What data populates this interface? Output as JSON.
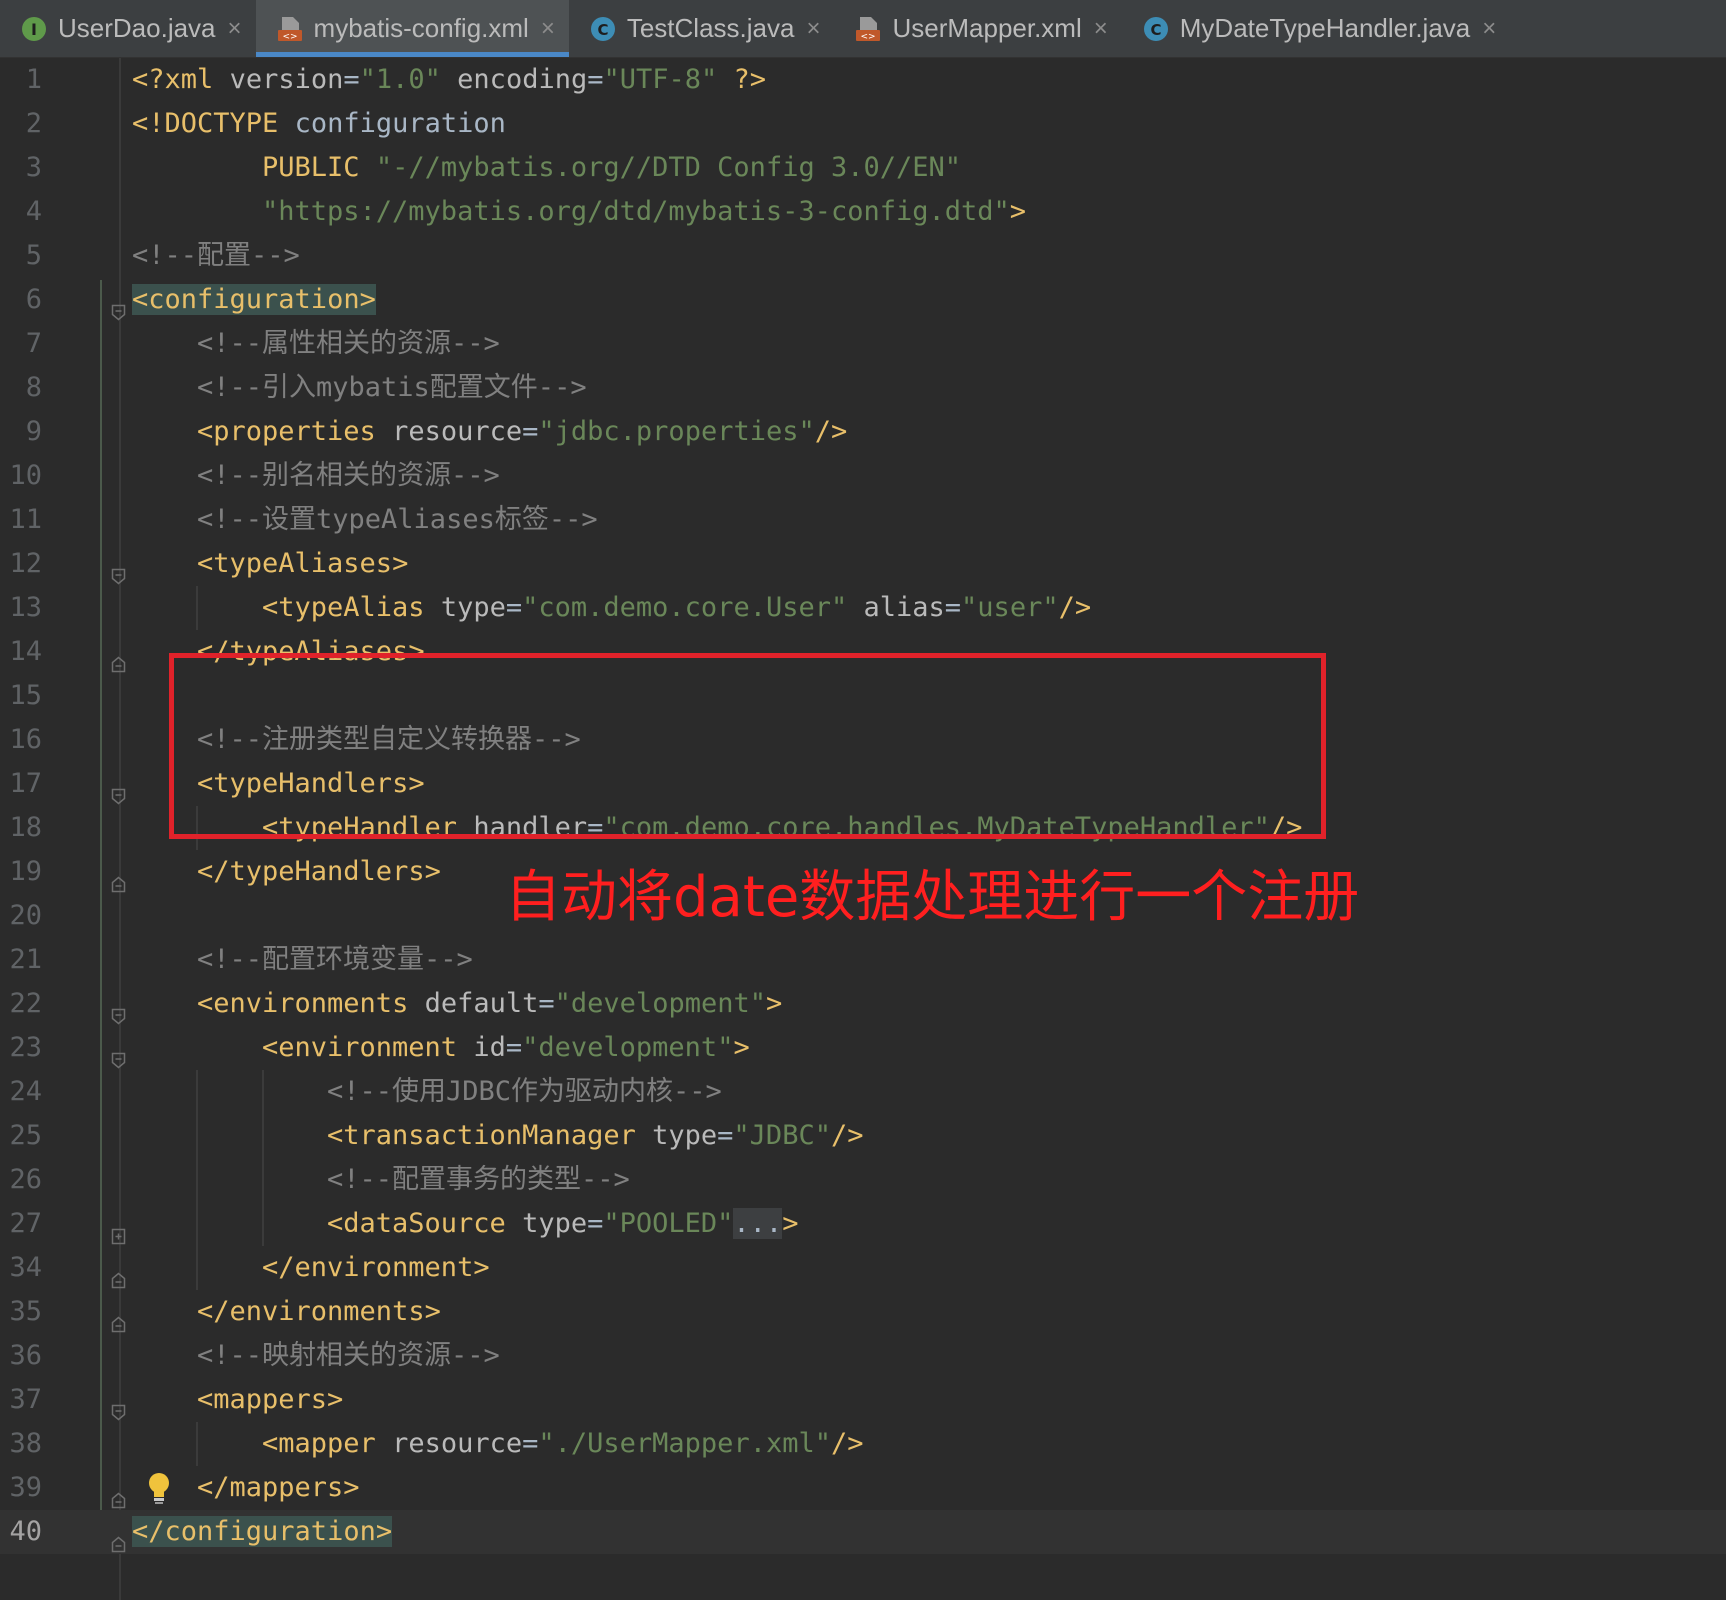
{
  "colors": {
    "background": "#2b2b2b",
    "tag": "#e8bf6a",
    "attribute": "#bababa",
    "value": "#6a8759",
    "comment": "#808080",
    "annotation": "#e0222a",
    "active_tab_underline": "#4a88c7"
  },
  "tabs": [
    {
      "label": "UserDao.java",
      "icon": "interface-icon",
      "active": false
    },
    {
      "label": "mybatis-config.xml",
      "icon": "xml-file-icon",
      "active": true
    },
    {
      "label": "TestClass.java",
      "icon": "class-icon",
      "active": false
    },
    {
      "label": "UserMapper.xml",
      "icon": "xml-file-icon",
      "active": false
    },
    {
      "label": "MyDateTypeHandler.java",
      "icon": "class-icon",
      "active": false
    }
  ],
  "tab_close_glyph": "×",
  "lines": [
    {
      "n": "1",
      "indent": 0,
      "tokens": [
        [
          "pi",
          "<?"
        ],
        [
          "tag",
          "xml"
        ],
        [
          "txt",
          " "
        ],
        [
          "attr",
          "version"
        ],
        [
          "txt",
          "="
        ],
        [
          "val",
          "\"1.0\""
        ],
        [
          "txt",
          " "
        ],
        [
          "attr",
          "encoding"
        ],
        [
          "txt",
          "="
        ],
        [
          "val",
          "\"UTF-8\""
        ],
        [
          "txt",
          " "
        ],
        [
          "pi",
          "?>"
        ]
      ]
    },
    {
      "n": "2",
      "indent": 0,
      "tokens": [
        [
          "tag",
          "<!DOCTYPE"
        ],
        [
          "txt",
          " configuration"
        ]
      ]
    },
    {
      "n": "3",
      "indent": 8,
      "tokens": [
        [
          "tag",
          "PUBLIC"
        ],
        [
          "txt",
          " "
        ],
        [
          "val",
          "\"-//mybatis.org//DTD Config 3.0//EN\""
        ]
      ]
    },
    {
      "n": "4",
      "indent": 8,
      "tokens": [
        [
          "val",
          "\"https://mybatis.org/dtd/mybatis-3-config.dtd\""
        ],
        [
          "tag",
          ">"
        ]
      ]
    },
    {
      "n": "5",
      "indent": 0,
      "tokens": [
        [
          "cmt",
          "<!--配置-->"
        ]
      ]
    },
    {
      "n": "6",
      "indent": 0,
      "fold": "open",
      "tokens": [
        [
          "matched",
          "<configuration>"
        ]
      ]
    },
    {
      "n": "7",
      "indent": 4,
      "tokens": [
        [
          "cmt",
          "<!--属性相关的资源-->"
        ]
      ]
    },
    {
      "n": "8",
      "indent": 4,
      "tokens": [
        [
          "cmt",
          "<!--引入mybatis配置文件-->"
        ]
      ]
    },
    {
      "n": "9",
      "indent": 4,
      "tokens": [
        [
          "tag",
          "<properties"
        ],
        [
          "txt",
          " "
        ],
        [
          "attr",
          "resource"
        ],
        [
          "txt",
          "="
        ],
        [
          "val",
          "\"jdbc.properties\""
        ],
        [
          "tag",
          "/>"
        ]
      ]
    },
    {
      "n": "10",
      "indent": 4,
      "tokens": [
        [
          "cmt",
          "<!--别名相关的资源-->"
        ]
      ]
    },
    {
      "n": "11",
      "indent": 4,
      "tokens": [
        [
          "cmt",
          "<!--设置typeAliases标签-->"
        ]
      ]
    },
    {
      "n": "12",
      "indent": 4,
      "fold": "open",
      "tokens": [
        [
          "tag",
          "<typeAliases>"
        ]
      ]
    },
    {
      "n": "13",
      "indent": 8,
      "tokens": [
        [
          "tag",
          "<typeAlias"
        ],
        [
          "txt",
          " "
        ],
        [
          "attr",
          "type"
        ],
        [
          "txt",
          "="
        ],
        [
          "val",
          "\"com.demo.core.User\""
        ],
        [
          "txt",
          " "
        ],
        [
          "attr",
          "alias"
        ],
        [
          "txt",
          "="
        ],
        [
          "val",
          "\"user\""
        ],
        [
          "tag",
          "/>"
        ]
      ]
    },
    {
      "n": "14",
      "indent": 4,
      "fold": "close",
      "tokens": [
        [
          "tag",
          "</typeAliases>"
        ]
      ]
    },
    {
      "n": "15",
      "indent": 0,
      "tokens": []
    },
    {
      "n": "16",
      "indent": 4,
      "tokens": [
        [
          "cmt",
          "<!--注册类型自定义转换器-->"
        ]
      ]
    },
    {
      "n": "17",
      "indent": 4,
      "fold": "open",
      "tokens": [
        [
          "tag",
          "<typeHandlers>"
        ]
      ]
    },
    {
      "n": "18",
      "indent": 8,
      "tokens": [
        [
          "tag",
          "<typeHandler"
        ],
        [
          "txt",
          " "
        ],
        [
          "attr",
          "handler"
        ],
        [
          "txt",
          "="
        ],
        [
          "val",
          "\"com.demo.core.handles.MyDateTypeHandler\""
        ],
        [
          "tag",
          "/>"
        ]
      ]
    },
    {
      "n": "19",
      "indent": 4,
      "fold": "close",
      "tokens": [
        [
          "tag",
          "</typeHandlers>"
        ]
      ]
    },
    {
      "n": "20",
      "indent": 0,
      "tokens": []
    },
    {
      "n": "21",
      "indent": 4,
      "tokens": [
        [
          "cmt",
          "<!--配置环境变量-->"
        ]
      ]
    },
    {
      "n": "22",
      "indent": 4,
      "fold": "open",
      "tokens": [
        [
          "tag",
          "<environments"
        ],
        [
          "txt",
          " "
        ],
        [
          "attr",
          "default"
        ],
        [
          "txt",
          "="
        ],
        [
          "val",
          "\"development\""
        ],
        [
          "tag",
          ">"
        ]
      ]
    },
    {
      "n": "23",
      "indent": 8,
      "fold": "open",
      "tokens": [
        [
          "tag",
          "<environment"
        ],
        [
          "txt",
          " "
        ],
        [
          "attr",
          "id"
        ],
        [
          "txt",
          "="
        ],
        [
          "val",
          "\"development\""
        ],
        [
          "tag",
          ">"
        ]
      ]
    },
    {
      "n": "24",
      "indent": 12,
      "tokens": [
        [
          "cmt",
          "<!--使用JDBC作为驱动内核-->"
        ]
      ]
    },
    {
      "n": "25",
      "indent": 12,
      "tokens": [
        [
          "tag",
          "<transactionManager"
        ],
        [
          "txt",
          " "
        ],
        [
          "attr",
          "type"
        ],
        [
          "txt",
          "="
        ],
        [
          "val",
          "\"JDBC\""
        ],
        [
          "tag",
          "/>"
        ]
      ]
    },
    {
      "n": "26",
      "indent": 12,
      "tokens": [
        [
          "cmt",
          "<!--配置事务的类型-->"
        ]
      ]
    },
    {
      "n": "27",
      "indent": 12,
      "fold": "plus",
      "tokens": [
        [
          "tag",
          "<dataSource"
        ],
        [
          "txt",
          " "
        ],
        [
          "attr",
          "type"
        ],
        [
          "txt",
          "="
        ],
        [
          "val",
          "\"POOLED\""
        ],
        [
          "collapsed",
          "..."
        ],
        [
          "tag",
          ">"
        ]
      ]
    },
    {
      "n": "34",
      "indent": 8,
      "fold": "close",
      "tokens": [
        [
          "tag",
          "</environment>"
        ]
      ]
    },
    {
      "n": "35",
      "indent": 4,
      "fold": "close",
      "tokens": [
        [
          "tag",
          "</environments>"
        ]
      ]
    },
    {
      "n": "36",
      "indent": 4,
      "tokens": [
        [
          "cmt",
          "<!--映射相关的资源-->"
        ]
      ]
    },
    {
      "n": "37",
      "indent": 4,
      "fold": "open",
      "tokens": [
        [
          "tag",
          "<mappers>"
        ]
      ]
    },
    {
      "n": "38",
      "indent": 8,
      "tokens": [
        [
          "tag",
          "<mapper"
        ],
        [
          "txt",
          " "
        ],
        [
          "attr",
          "resource"
        ],
        [
          "txt",
          "="
        ],
        [
          "val",
          "\"./UserMapper.xml\""
        ],
        [
          "tag",
          "/>"
        ]
      ]
    },
    {
      "n": "39",
      "indent": 4,
      "fold": "close",
      "bulb": true,
      "tokens": [
        [
          "tag",
          "</mappers>"
        ]
      ]
    },
    {
      "n": "40",
      "indent": 0,
      "fold": "close",
      "current": true,
      "tokens": [
        [
          "matched",
          "</configuration>"
        ]
      ]
    }
  ],
  "annotation": {
    "text": "自动将date数据处理进行一个注册"
  }
}
